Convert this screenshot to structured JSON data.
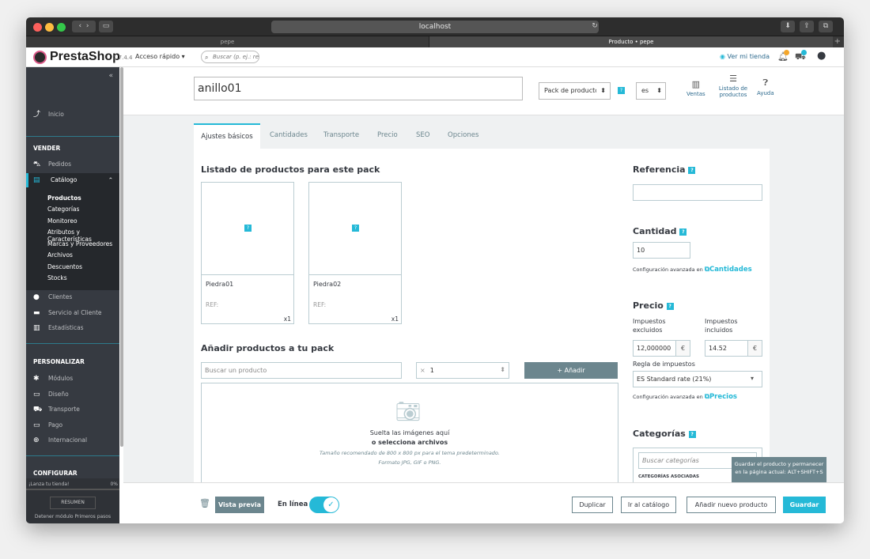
{
  "browser": {
    "url": "localhost",
    "tabs": [
      {
        "label": "pepe"
      },
      {
        "label": "Producto • pepe"
      }
    ]
  },
  "header": {
    "brand": "PrestaShop",
    "version": "1.7.4.4",
    "quick_access": "Acceso rápido ▾",
    "search_placeholder": "Buscar (p. ej.: re",
    "view_store": "Ver mi tienda"
  },
  "sidebar": {
    "collapse": "«",
    "home": "Inicio",
    "sections": [
      {
        "title": "VENDER"
      },
      {
        "title": "PERSONALIZAR"
      },
      {
        "title": "CONFIGURAR"
      }
    ],
    "vender_items": [
      "Pedidos",
      "Catálogo",
      "Clientes",
      "Servicio al Cliente",
      "Estadísticas"
    ],
    "catalog_sub": [
      "Productos",
      "Categorías",
      "Monitoreo",
      "Atributos y Características",
      "Marcas y Proveedores",
      "Archivos",
      "Descuentos",
      "Stocks"
    ],
    "personalizar_items": [
      "Módulos",
      "Diseño",
      "Transporte",
      "Pago",
      "Internacional"
    ],
    "launch": "¡Lanza tu tienda!",
    "launch_pct": "0%",
    "resume": "RESUMEN",
    "stop_module": "Detener módulo Primeros pasos"
  },
  "toolbar": {
    "product_name": "anillo01",
    "product_type": "Pack de producto",
    "language": "es",
    "sales": "Ventas",
    "product_list": "Listado de productos",
    "help": "Ayuda"
  },
  "tabs": [
    "Ajustes básicos",
    "Cantidades",
    "Transporte",
    "Precio",
    "SEO",
    "Opciones"
  ],
  "pack": {
    "title": "Listado de productos para este pack",
    "items": [
      {
        "name": "Piedra01",
        "ref": "REF:",
        "qty": "x1"
      },
      {
        "name": "Piedra02",
        "ref": "REF:",
        "qty": "x1"
      }
    ],
    "add_title": "Añadir productos a tu pack",
    "search_placeholder": "Buscar un producto",
    "qty_value": "1",
    "add_button": "+ Añadir",
    "help_icon": "?"
  },
  "dropzone": {
    "line1": "Suelta las imágenes aquí",
    "line2": "o selecciona archivos",
    "line3": "Tamaño recomendado de 800 x 800 px para el tema predeterminado.",
    "line4": "Formato JPG, GIF o PNG."
  },
  "right": {
    "reference_title": "Referencia",
    "quantity_title": "Cantidad",
    "quantity_value": "10",
    "adv_config": "Configuración avanzada en",
    "quantities_link": "Cantidades",
    "price_title": "Precio",
    "tax_excl_label": "Impuestos excluidos",
    "tax_incl_label": "Impuestos incluidos",
    "tax_excl_value": "12,000000",
    "tax_incl_value": "14.52",
    "currency": "€",
    "tax_rule_label": "Regla de impuestos",
    "tax_rule_value": "ES Standard rate (21%)",
    "prices_link": "Precios",
    "categories_title": "Categorías",
    "categories_placeholder": "Buscar categorías",
    "assoc_categories": "CATEGORÍAS ASOCIADAS"
  },
  "tooltip": "Guardar el producto y permanecer en la página actual: ALT+SHIFT+S",
  "footer": {
    "preview": "Vista previa",
    "online": "En línea",
    "duplicate": "Duplicar",
    "catalog": "Ir al catálogo",
    "new_product": "Añadir nuevo producto",
    "save": "Guardar"
  },
  "colors": {
    "accent": "#25b9d7",
    "sidebar": "#363a41",
    "muted": "#6c868e"
  }
}
